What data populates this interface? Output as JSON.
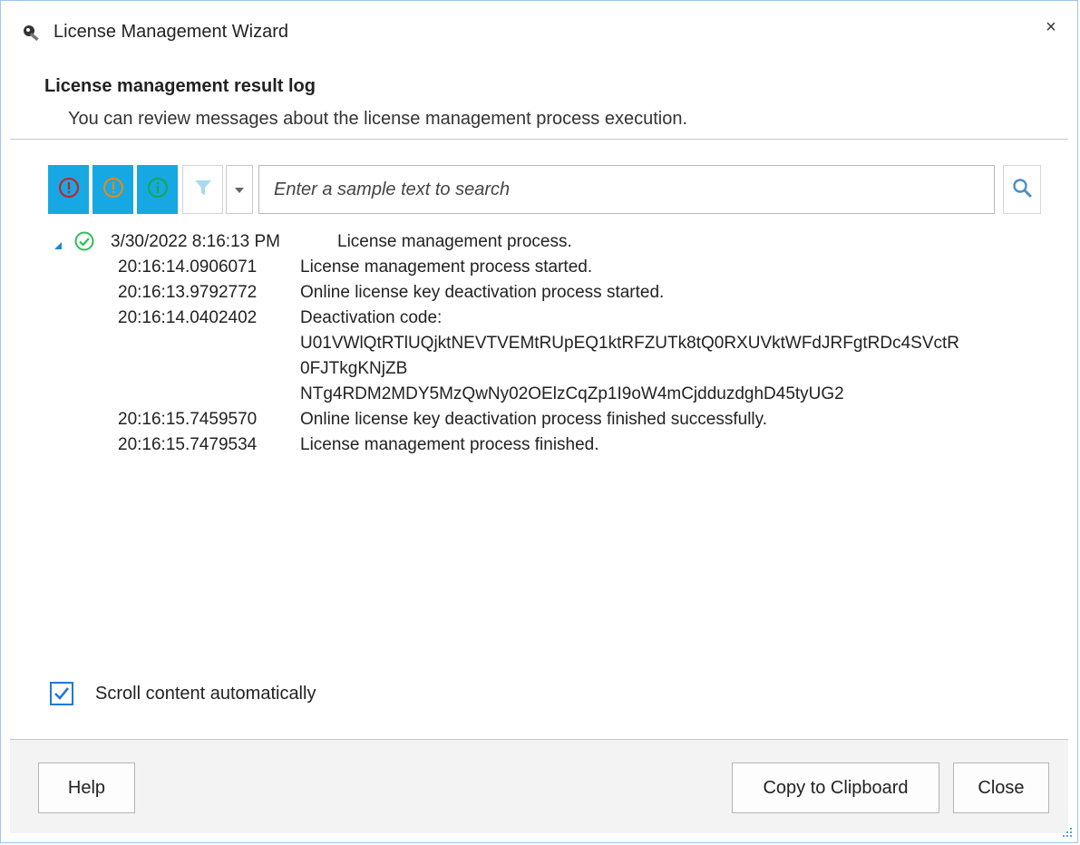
{
  "window": {
    "title": "License Management Wizard",
    "close_glyph": "×",
    "icon": "key-icon"
  },
  "header": {
    "title": "License management result log",
    "subtitle": "You can review messages about the license management process execution."
  },
  "toolbar": {
    "error_filter": {
      "icon": "error-icon",
      "color": "#c0272d",
      "active": true
    },
    "warning_filter": {
      "icon": "warning-icon",
      "color": "#e08a1e",
      "active": true
    },
    "info_filter": {
      "icon": "info-icon",
      "color": "#18a65a",
      "active": true
    },
    "filter_icon": "funnel-icon",
    "dropdown_icon": "chevron-down-icon",
    "search_placeholder": "Enter a sample text to search",
    "search_icon": "search-icon"
  },
  "log": {
    "root": {
      "timestamp": "3/30/2022 8:16:13 PM",
      "message": "License management process.",
      "status_icon": "success-check-icon"
    },
    "entries": [
      {
        "time": "20:16:14.0906071",
        "lines": [
          "License management process started."
        ]
      },
      {
        "time": "20:16:13.9792772",
        "lines": [
          "Online license key deactivation process started."
        ]
      },
      {
        "time": "20:16:14.0402402",
        "lines": [
          "Deactivation code:",
          "U01VWlQtRTlUQjktNEVTVEMtRUpEQ1ktRFZUTk8tQ0RXUVktWFdJRFgtRDc4SVctR",
          "0FJTkgKNjZB",
          "NTg4RDM2MDY5MzQwNy02OElzCqZp1I9oW4mCjdduzdghD45tyUG2"
        ]
      },
      {
        "time": "20:16:15.7459570",
        "lines": [
          "Online license key deactivation process finished successfully."
        ]
      },
      {
        "time": "20:16:15.7479534",
        "lines": [
          "License management process finished."
        ]
      }
    ]
  },
  "options": {
    "auto_scroll_label": "Scroll content automatically",
    "auto_scroll_checked": true
  },
  "buttons": {
    "help": "Help",
    "copy": "Copy to Clipboard",
    "close": "Close"
  },
  "colors": {
    "accent": "#17a8e3",
    "success": "#2dbd5a"
  }
}
